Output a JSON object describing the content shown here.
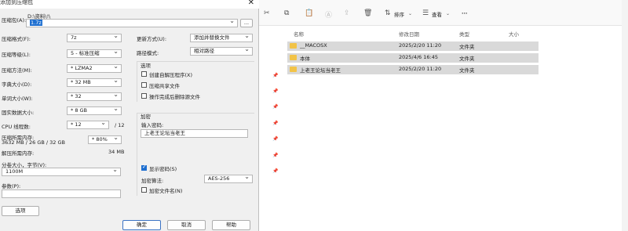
{
  "dialog": {
    "title": "添加到压缩包",
    "close": "✕",
    "archive_label": "压缩包(A):",
    "path_text": "D:\\资料\\!\\",
    "archive_value": "1.7z",
    "browse": "...",
    "format_label": "压缩格式(F):",
    "format_value": "7z",
    "level_label": "压缩等级(L):",
    "level_value": "5 - 标准压缩",
    "method_label": "压缩方法(M):",
    "method_value": "* LZMA2",
    "dict_label": "字典大小(D):",
    "dict_value": "* 32 MB",
    "word_label": "单词大小(W):",
    "word_value": "* 32",
    "solid_label": "固实数据大小:",
    "solid_value": "* 8 GB",
    "cpu_label": "CPU 线程数:",
    "cpu_value": "* 12",
    "cpu_total": "/ 12",
    "mem_label": "压缩所需内存:",
    "mem_detail": "3632 MB / 26 GB / 32 GB",
    "mem_value": "* 80%",
    "decomp_label": "解压所需内存:",
    "decomp_value": "34 MB",
    "split_label": "分卷大小，字节(V):",
    "split_value": "1100M",
    "params_label": "参数(P):",
    "options_btn": "选项",
    "update_label": "更新方式(U):",
    "update_value": "添加并替换文件",
    "pathmode_label": "路径模式:",
    "pathmode_value": "相对路径",
    "opts_title": "选项",
    "opt_sfx": "创建自解压程序(X)",
    "opt_shared": "压缩共享文件",
    "opt_delete": "操作完成后删除源文件",
    "enc_title": "加密",
    "pwd_label": "输入密码:",
    "pwd_value": "上老王论坛当老王",
    "show_pwd": "显示密码(S)",
    "enc_method_label": "加密算法:",
    "enc_method_value": "AES-256",
    "enc_names": "加密文件名(N)",
    "ok": "确定",
    "cancel": "取消",
    "help": "帮助"
  },
  "explorer": {
    "toolbar": {
      "sort": "排序",
      "view": "查看",
      "more": "···"
    },
    "columns": {
      "name": "名称",
      "date": "修改日期",
      "type": "类型",
      "size": "大小"
    },
    "rows": [
      {
        "name": "__MACOSX",
        "date": "2025/2/20 11:20",
        "type": "文件夹"
      },
      {
        "name": "本体",
        "date": "2025/4/6 16:45",
        "type": "文件夹"
      },
      {
        "name": "上老王论坛当老王",
        "date": "2025/2/20 11:20",
        "type": "文件夹"
      }
    ]
  }
}
